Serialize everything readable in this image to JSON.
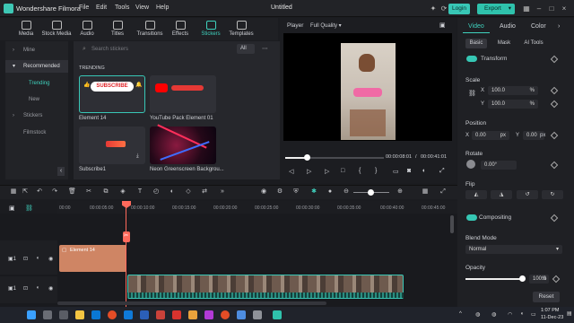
{
  "titlebar": {
    "app_name": "Wondershare Filmora",
    "menus": [
      "File",
      "Edit",
      "Tools",
      "View",
      "Help"
    ],
    "project": "Untitled",
    "login": "Login",
    "export": "Export"
  },
  "top_tabs": [
    "Media",
    "Stock Media",
    "Audio",
    "Titles",
    "Transitions",
    "Effects",
    "Stickers",
    "Templates"
  ],
  "active_tab": "Stickers",
  "sidebar": {
    "items": [
      {
        "label": "Mine"
      },
      {
        "label": "Recommended"
      },
      {
        "label": "Trending"
      },
      {
        "label": "New"
      },
      {
        "label": "Stickers"
      },
      {
        "label": "Filmstock"
      }
    ]
  },
  "search": {
    "placeholder": "Search stickers",
    "filter": "All"
  },
  "content": {
    "section": "TRENDING",
    "thumbs": [
      {
        "label": "Element 14",
        "badge": "SUBSCRIBE"
      },
      {
        "label": "YouTube Pack Element 01"
      },
      {
        "label": "Subscribe1"
      },
      {
        "label": "Neon Greenscreen Backgrou..."
      }
    ]
  },
  "player": {
    "label": "Player",
    "quality": "Full Quality",
    "time_current": "00:00:08:01",
    "time_total": "00:00:41:01"
  },
  "props": {
    "tabs": [
      "Video",
      "Audio",
      "Color"
    ],
    "subtabs": [
      "Basic",
      "Mask",
      "AI Tools"
    ],
    "transform": "Transform",
    "scale": "Scale",
    "scale_x": "100.0",
    "scale_y": "100.0",
    "percent": "%",
    "position": "Position",
    "pos_x": "0.00",
    "pos_y": "0.00",
    "px": "px",
    "rotate": "Rotate",
    "rotate_val": "0.00°",
    "flip": "Flip",
    "compositing": "Compositing",
    "blend_mode": "Blend Mode",
    "blend_val": "Normal",
    "opacity": "Opacity",
    "opacity_val": "100.0",
    "reset": "Reset",
    "x": "X",
    "y": "Y"
  },
  "timeline": {
    "ticks": [
      "00:00",
      "00:00:05:00",
      "00:00:10:00",
      "00:00:15:00",
      "00:00:20:00",
      "00:00:25:00",
      "00:00:30:00",
      "00:00:35:00",
      "00:00:40:00",
      "00:00:45:00"
    ],
    "clip1_label": "Element 14",
    "track_labels": [
      "1",
      "1"
    ]
  },
  "taskbar": {
    "time": "1:07 PM",
    "date": "11-Dec-23",
    "accent": "#38c7b6"
  }
}
